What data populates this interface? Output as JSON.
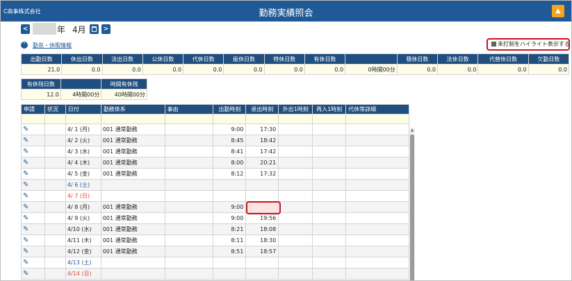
{
  "header": {
    "company": "C商事株式会社",
    "title": "勤務実績照会",
    "bell_icon": "bell-icon"
  },
  "period": {
    "year_suffix": "年",
    "month": "4月",
    "prev": "<",
    "next": ">"
  },
  "leave_toggle": {
    "label": "勤怠・休暇情報"
  },
  "highlight_option": {
    "label": "未打刻をハイライト表示する",
    "checked": true
  },
  "summary": {
    "headers": [
      "出勤日数",
      "休出日数",
      "法出日数",
      "公休日数",
      "代休日数",
      "振休日数",
      "特休日数",
      "有休日数",
      "",
      "積休日数",
      "法休日数",
      "代替休日数",
      "欠勤日数"
    ],
    "values": [
      "21.0",
      "0.0",
      "0.0",
      "0.0",
      "0.0",
      "0.0",
      "0.0",
      "0.0",
      "0時間00分",
      "0.0",
      "0.0",
      "0.0",
      "0.0"
    ]
  },
  "paid_leave": {
    "headers": [
      "有休残日数",
      "",
      "時間有休残"
    ],
    "values": [
      "12.0",
      "4時間00分",
      "40時間00分"
    ]
  },
  "attendance": {
    "headers": [
      "申請",
      "状況",
      "日付",
      "勤務体系",
      "事由",
      "出勤時刻",
      "退出時刻",
      "外出1時刻",
      "再入1時刻",
      "代休等詳細"
    ],
    "rows": [
      {
        "date": "4/ 1 (月)",
        "type": "001 通常勤務",
        "in": "9:00",
        "out": "17:30",
        "day": ""
      },
      {
        "date": "4/ 2 (火)",
        "type": "001 通常勤務",
        "in": "8:45",
        "out": "18:42",
        "day": ""
      },
      {
        "date": "4/ 3 (水)",
        "type": "001 通常勤務",
        "in": "8:41",
        "out": "17:42",
        "day": ""
      },
      {
        "date": "4/ 4 (木)",
        "type": "001 通常勤務",
        "in": "8:00",
        "out": "20:21",
        "day": ""
      },
      {
        "date": "4/ 5 (金)",
        "type": "001 通常勤務",
        "in": "8:12",
        "out": "17:32",
        "day": ""
      },
      {
        "date": "4/ 6 (土)",
        "type": "",
        "in": "",
        "out": "",
        "day": "sat"
      },
      {
        "date": "4/ 7 (日)",
        "type": "",
        "in": "",
        "out": "",
        "day": "sun"
      },
      {
        "date": "4/ 8 (月)",
        "type": "001 通常勤務",
        "in": "9:00",
        "out": "",
        "day": "",
        "missing": true
      },
      {
        "date": "4/ 9 (火)",
        "type": "001 通常勤務",
        "in": "9:00",
        "out": "19:56",
        "day": ""
      },
      {
        "date": "4/10 (水)",
        "type": "001 通常勤務",
        "in": "8:21",
        "out": "18:08",
        "day": ""
      },
      {
        "date": "4/11 (木)",
        "type": "001 通常勤務",
        "in": "8:11",
        "out": "18:30",
        "day": ""
      },
      {
        "date": "4/12 (金)",
        "type": "001 通常勤務",
        "in": "8:51",
        "out": "18:57",
        "day": ""
      },
      {
        "date": "4/13 (土)",
        "type": "",
        "in": "",
        "out": "",
        "day": "sat"
      },
      {
        "date": "4/14 (日)",
        "type": "",
        "in": "",
        "out": "",
        "day": "sun"
      }
    ]
  },
  "colors": {
    "header_bg": "#1f5a96",
    "table_header_bg": "#1f4e7f",
    "highlight_border": "#d0101c",
    "missing_fill": "#fde4e4"
  }
}
